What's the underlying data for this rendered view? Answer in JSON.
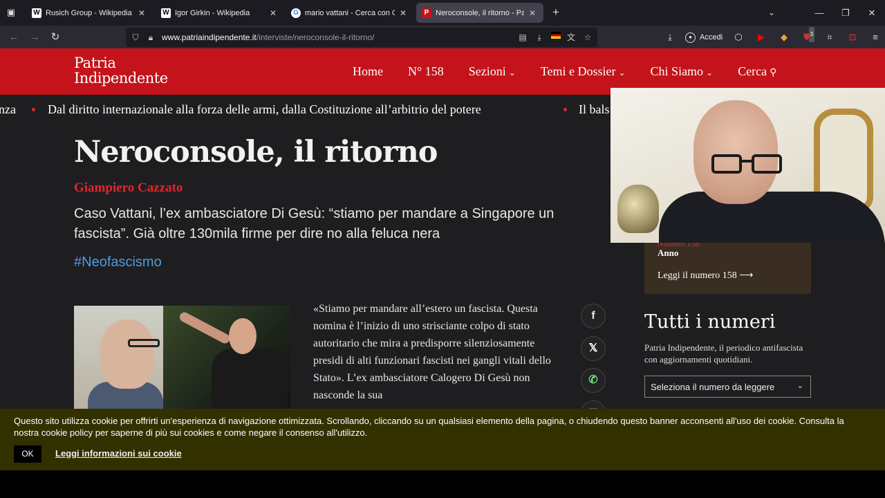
{
  "browser": {
    "tabs": [
      {
        "title": "Rusich Group - Wikipedia",
        "favicon": "W"
      },
      {
        "title": "Igor Girkin - Wikipedia",
        "favicon": "W"
      },
      {
        "title": "mario vattani - Cerca con Googl",
        "favicon": "G"
      },
      {
        "title": "Neroconsole, il ritorno - Patria I",
        "favicon": "P"
      }
    ],
    "url_domain": "www.patriaindipendente.it",
    "url_path": "/interviste/neroconsole-il-ritorno/",
    "account_label": "Accedi",
    "extension_badge": "3"
  },
  "site": {
    "logo_line1": "Patria",
    "logo_line2": "Indipendente",
    "nav": {
      "home": "Home",
      "issue": "N° 158",
      "sezioni": "Sezioni",
      "temi": "Temi e Dossier",
      "chi_siamo": "Chi Siamo",
      "cerca": "Cerca"
    },
    "ticker": {
      "left_fragment": "nza",
      "headline": "Dal diritto internazionale alla forza delle armi, dalla Costituzione all’arbitrio del potere",
      "right_fragment": "Il bals"
    }
  },
  "article": {
    "title": "Neroconsole, il ritorno",
    "author": "Giampiero Cazzato",
    "summary": "Caso Vattani, l’ex ambasciatore Di Gesù: “stiamo per mandare a Singapore un fascista”. Già oltre 130mila firme per dire no alla feluca nera",
    "tag": "#Neofascismo",
    "body": "«Stiamo per mandare all’estero un fascista. Questa nomina è l’inizio di uno strisciante colpo di stato autoritario che mira a predisporre silenziosamente presidi di alti funzionari fascisti nei gangli vitali dello Stato». L’ex ambasciatore Calogero Di Gesù non nasconde la sua"
  },
  "sidebar": {
    "issue_number": "Numero 158",
    "issue_year_label": "Anno",
    "issue_link": "Leggi il numero 158 ⟶",
    "all_issues_title": "Tutti i numeri",
    "all_issues_desc": "Patria Indipendente, il periodico antifascista con aggiornamenti quotidiani.",
    "select_placeholder": "Seleziona il numero da leggere"
  },
  "cookie": {
    "text": "Questo sito utilizza cookie per offrirti un'esperienza di navigazione ottimizzata. Scrollando, cliccando su un qualsiasi elemento della pagina, o chiudendo questo banner acconsenti all'uso dei cookie. Consulta la nostra cookie policy per saperne di più sui cookies e come negare il consenso all'utilizzo.",
    "ok_label": "OK",
    "info_link": "Leggi informazioni sui cookie"
  },
  "colors": {
    "brand_red": "#c4131a",
    "tag_blue": "#4f9be0",
    "cookie_bg": "#333000"
  }
}
